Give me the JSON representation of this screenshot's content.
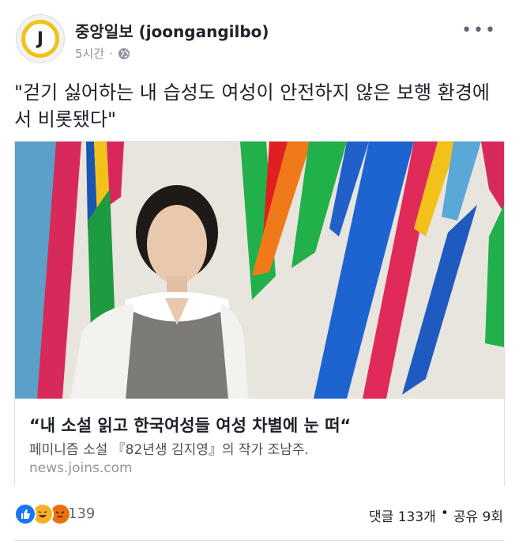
{
  "header": {
    "avatar_letter": "J",
    "page_name": "중앙일보 (joongangilbo)",
    "time": "5시간",
    "dot": "·",
    "privacy_icon": "globe-icon",
    "more": "•••"
  },
  "post": {
    "text": "\"걷기 싫어하는 내 습성도 여성이 안전하지 않은 보행 환경에서 비롯됐다\""
  },
  "link_card": {
    "title": "“내 소설 읽고 한국여성들 여성 차별에 눈 떠“",
    "description": "페미니즘 소설 『82년생 김지영』의 작가 조남주.",
    "domain": "news.joins.com"
  },
  "footer": {
    "reaction_icons": [
      "like-icon",
      "haha-icon",
      "angry-icon"
    ],
    "reaction_count": "139",
    "comments": "댓글 133개",
    "separator": "•",
    "shares": "공유 9회"
  },
  "colors": {
    "brand_yellow": "#f3c21a",
    "like_blue": "#1877f2",
    "haha_yellow": "#f7b125",
    "angry_orange": "#e9710f",
    "text_primary": "#1d2129",
    "text_secondary": "#90949c"
  }
}
